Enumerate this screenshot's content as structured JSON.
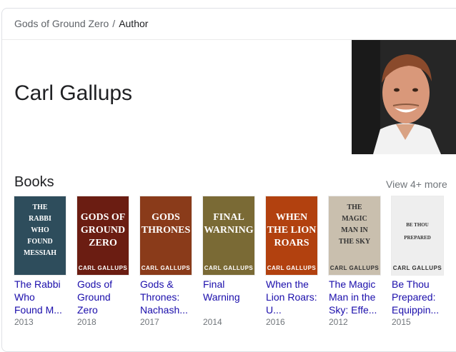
{
  "breadcrumb": {
    "parent": "Gods of Ground Zero",
    "separator": "/",
    "current": "Author"
  },
  "author": {
    "name": "Carl Gallups"
  },
  "books_section": {
    "heading": "Books",
    "view_more": "View 4+ more"
  },
  "books": [
    {
      "title_lines": [
        "The Rabbi",
        "Who",
        "Found M..."
      ],
      "year": "2013",
      "cover": {
        "lines": [
          "THE",
          "RABBI",
          "WHO",
          "FOUND",
          "MESSIAH"
        ],
        "author": "",
        "bg": "#2e4d5c"
      }
    },
    {
      "title_lines": [
        "Gods of",
        "Ground",
        "Zero"
      ],
      "year": "2018",
      "cover": {
        "lines": [
          "GODS OF",
          "GROUND",
          "ZERO"
        ],
        "author": "CARL GALLUPS",
        "bg": "#6b1d12"
      }
    },
    {
      "title_lines": [
        "Gods &",
        "Thrones:",
        "Nachash..."
      ],
      "year": "2017",
      "cover": {
        "lines": [
          "GODS",
          "THRONES"
        ],
        "author": "CARL GALLUPS",
        "bg": "#8a3b1a"
      }
    },
    {
      "title_lines": [
        "Final",
        "Warning"
      ],
      "year": "2014",
      "cover": {
        "lines": [
          "FINAL",
          "WARNING"
        ],
        "author": "CARL GALLUPS",
        "bg": "#7a6a35"
      }
    },
    {
      "title_lines": [
        "When the",
        "Lion Roars:",
        "U..."
      ],
      "year": "2016",
      "cover": {
        "lines": [
          "WHEN",
          "THE LION",
          "ROARS"
        ],
        "author": "CARL GALLUPS",
        "bg": "#b2410f"
      }
    },
    {
      "title_lines": [
        "The Magic",
        "Man in the",
        "Sky: Effe..."
      ],
      "year": "2012",
      "cover": {
        "lines": [
          "THE",
          "MAGIC",
          "MAN IN",
          "THE SKY"
        ],
        "author": "CARL GALLUPS",
        "bg": "#c9bfae"
      }
    },
    {
      "title_lines": [
        "Be Thou",
        "Prepared:",
        "Equippin..."
      ],
      "year": "2015",
      "cover": {
        "lines": [
          "BE THOU",
          "PREPARED"
        ],
        "author": "CARL GALLUPS",
        "bg": "#eeeeee"
      }
    }
  ]
}
